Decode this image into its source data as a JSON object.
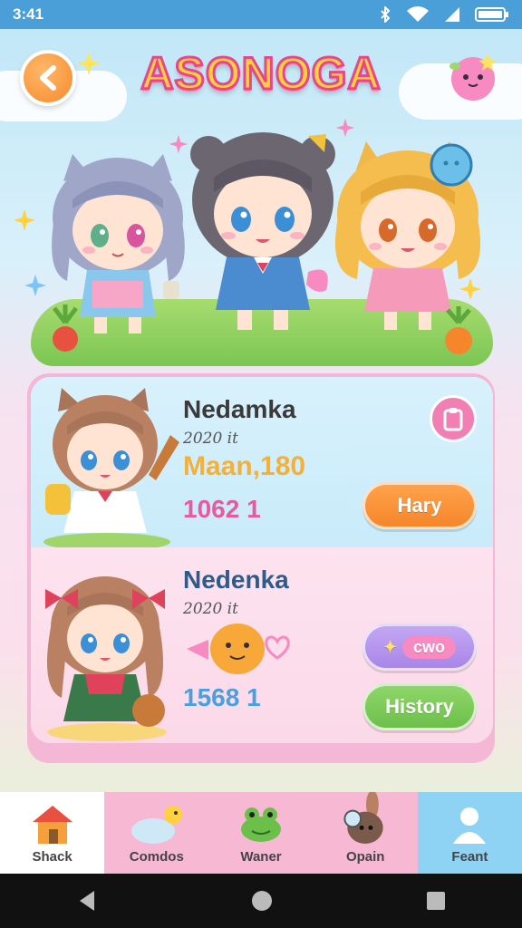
{
  "status_bar": {
    "time": "3:41"
  },
  "header": {
    "title": "ASONOGA"
  },
  "cards": [
    {
      "name": "Nedamka",
      "subtitle": "2020 it",
      "highlight": "Maan,180",
      "number": "1062 1",
      "button_label": "Hary"
    },
    {
      "name": "Nedenka",
      "subtitle": "2020 it",
      "number": "1568 1",
      "badge_label": "cwo",
      "button_label": "History"
    }
  ],
  "bottom_nav": [
    {
      "label": "Shack",
      "icon": "house-icon"
    },
    {
      "label": "Comdos",
      "icon": "cloud-bird-icon"
    },
    {
      "label": "Waner",
      "icon": "frog-icon"
    },
    {
      "label": "Opain",
      "icon": "bunny-icon"
    },
    {
      "label": "Feant",
      "icon": "profile-icon"
    }
  ],
  "colors": {
    "status_bar": "#4a9fd9",
    "accent_orange": "#f58a2c",
    "accent_pink": "#f27fb4",
    "accent_green": "#6cc04a",
    "accent_purple": "#a886e8",
    "title_yellow": "#ffd23d"
  }
}
